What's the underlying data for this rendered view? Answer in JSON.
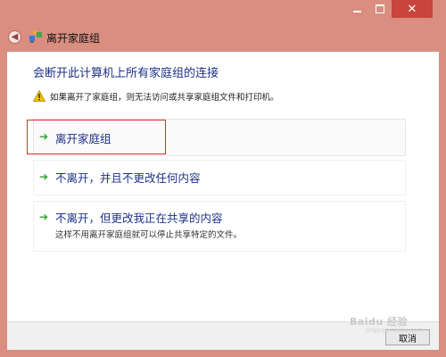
{
  "window": {
    "title": "离开家庭组",
    "back_icon": "back-arrow-icon",
    "app_icon": "homegroup-icon"
  },
  "content": {
    "heading": "会断开此计算机上所有家庭组的连接",
    "warning": "如果离开了家庭组，则无法访问或共享家庭组文件和打印机。",
    "options": [
      {
        "label": "离开家庭组"
      },
      {
        "label": "不离开，并且不更改任何内容"
      },
      {
        "label": "不离开，但更改我正在共享的内容",
        "sublabel": "这样不用离开家庭组就可以停止共享特定的文件。"
      }
    ]
  },
  "footer": {
    "cancel_label": "取消"
  },
  "watermark": {
    "text": "Baidu 经验",
    "sub": "jingyan.baidu.com"
  },
  "colors": {
    "window_frame": "#d98e80",
    "close_button": "#c7453c",
    "heading_blue": "#1e3287",
    "arrow_green": "#2e9e2e",
    "highlight_red": "#e0272b"
  }
}
